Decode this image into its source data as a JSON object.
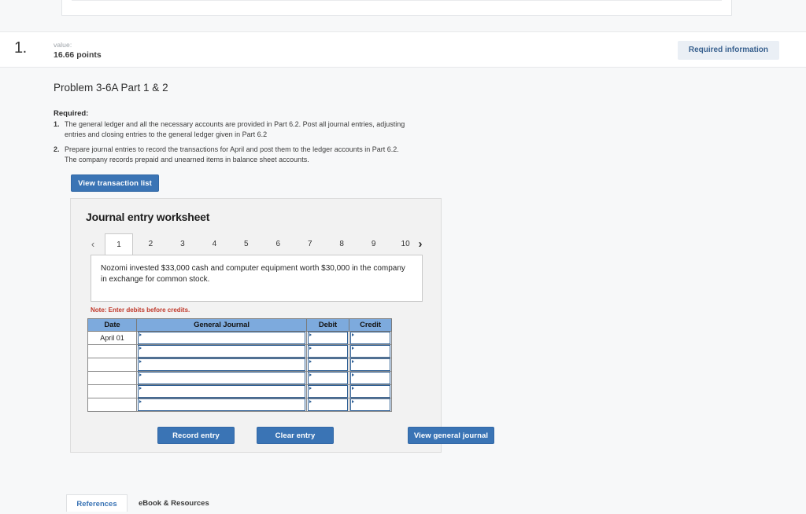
{
  "question": {
    "number": "1.",
    "value_label": "value:",
    "points": "16.66 points",
    "required_badge": "Required information"
  },
  "problem": {
    "title": "Problem 3-6A Part 1 & 2",
    "required_heading": "Required:",
    "requirements": [
      {
        "num": "1.",
        "text": "The general ledger and all the necessary accounts are provided in Part 6.2. Post all journal entries, adjusting entries and closing entries to the general ledger given in Part 6.2"
      },
      {
        "num": "2.",
        "text": "Prepare journal entries to record the transactions for April and post them to the ledger accounts in Part 6.2. The company records prepaid and unearned items in balance sheet accounts."
      }
    ],
    "view_transaction_list": "View transaction list"
  },
  "worksheet": {
    "title": "Journal entry worksheet",
    "prev_arrow": "‹",
    "next_arrow": "›",
    "tabs": [
      "1",
      "2",
      "3",
      "4",
      "5",
      "6",
      "7",
      "8",
      "9",
      "10"
    ],
    "active_tab": "1",
    "description": "Nozomi invested $33,000 cash and computer equipment worth $30,000 in the company in exchange for common stock.",
    "note": "Note: Enter debits before credits.",
    "table": {
      "headers": [
        "Date",
        "General Journal",
        "Debit",
        "Credit"
      ],
      "rows": [
        {
          "date": "April 01",
          "general_journal": "",
          "debit": "",
          "credit": ""
        },
        {
          "date": "",
          "general_journal": "",
          "debit": "",
          "credit": ""
        },
        {
          "date": "",
          "general_journal": "",
          "debit": "",
          "credit": ""
        },
        {
          "date": "",
          "general_journal": "",
          "debit": "",
          "credit": ""
        },
        {
          "date": "",
          "general_journal": "",
          "debit": "",
          "credit": ""
        },
        {
          "date": "",
          "general_journal": "",
          "debit": "",
          "credit": ""
        }
      ]
    },
    "buttons": {
      "record": "Record entry",
      "clear": "Clear entry",
      "view_general_journal": "View general journal"
    }
  },
  "footer": {
    "references_tab": "References",
    "ebook_tab": "eBook & Resources"
  },
  "colors": {
    "accent_blue": "#3a74b5",
    "table_header_blue": "#7daadd",
    "badge_bg": "#eaeff5",
    "badge_text": "#39618f",
    "note_red": "#c0392b"
  }
}
